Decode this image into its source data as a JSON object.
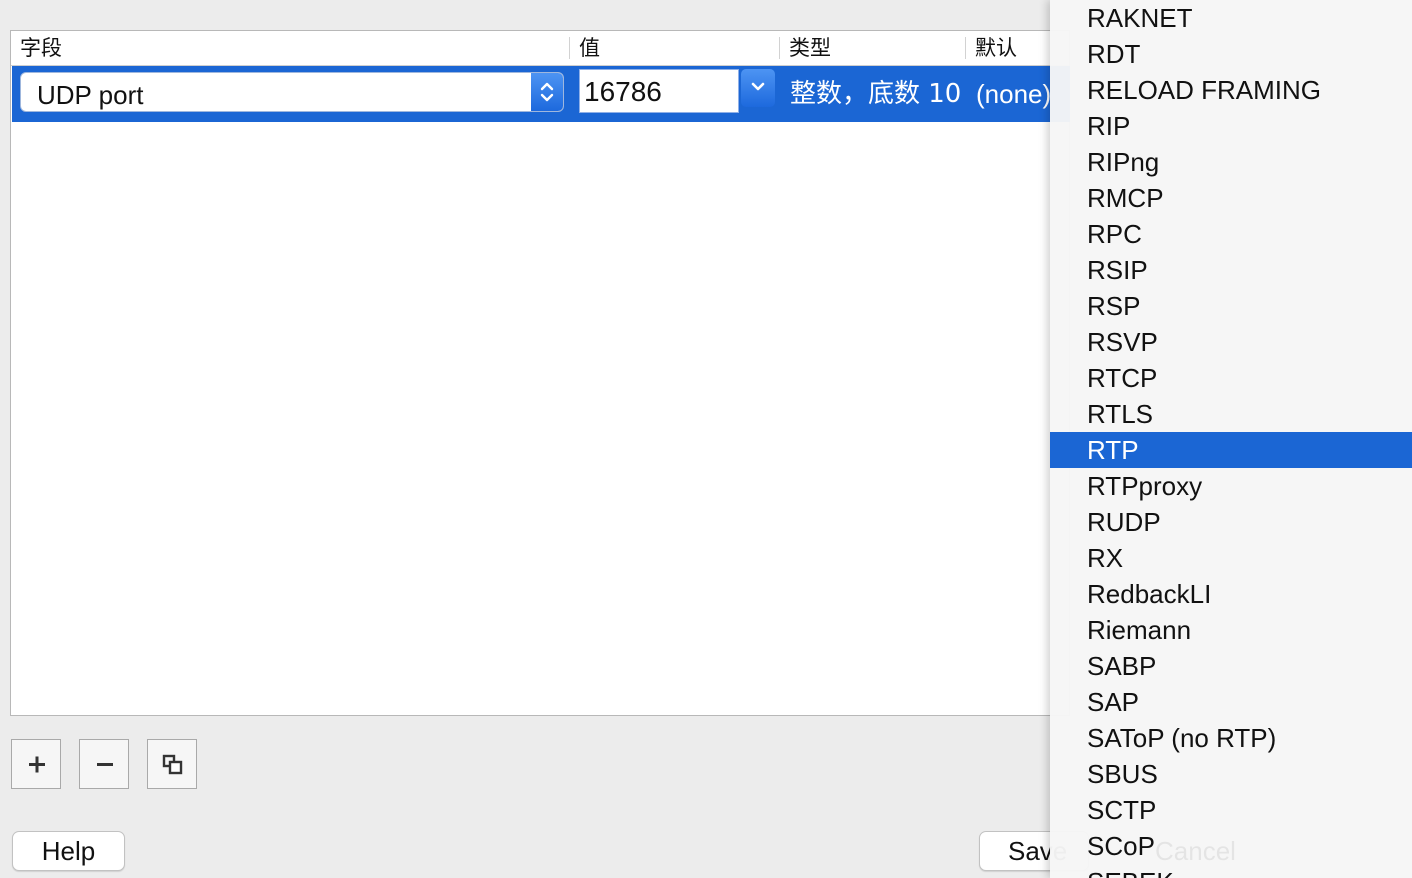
{
  "table": {
    "headers": [
      "字段",
      "值",
      "类型",
      "默认"
    ],
    "row": {
      "field": "UDP port",
      "value": "16786",
      "type": "整数，底数 10",
      "default": "(none)"
    }
  },
  "toolbar": {
    "add_icon": "plus-icon",
    "remove_icon": "minus-icon",
    "copy_icon": "copy-icon"
  },
  "buttons": {
    "help": "Help",
    "save": "Save",
    "cancel": "Cancel"
  },
  "dropdown": {
    "items": [
      "RAKNET",
      "RDT",
      "RELOAD FRAMING",
      "RIP",
      "RIPng",
      "RMCP",
      "RPC",
      "RSIP",
      "RSP",
      "RSVP",
      "RTCP",
      "RTLS",
      "RTP",
      "RTPproxy",
      "RUDP",
      "RX",
      "RedbackLI",
      "Riemann",
      "SABP",
      "SAP",
      "SAToP (no RTP)",
      "SBUS",
      "SCTP",
      "SCoP",
      "SEBEK"
    ],
    "selected": "RTP"
  },
  "colors": {
    "selection": "#1b66d4",
    "accent_gradient_top": "#4d94f3"
  }
}
